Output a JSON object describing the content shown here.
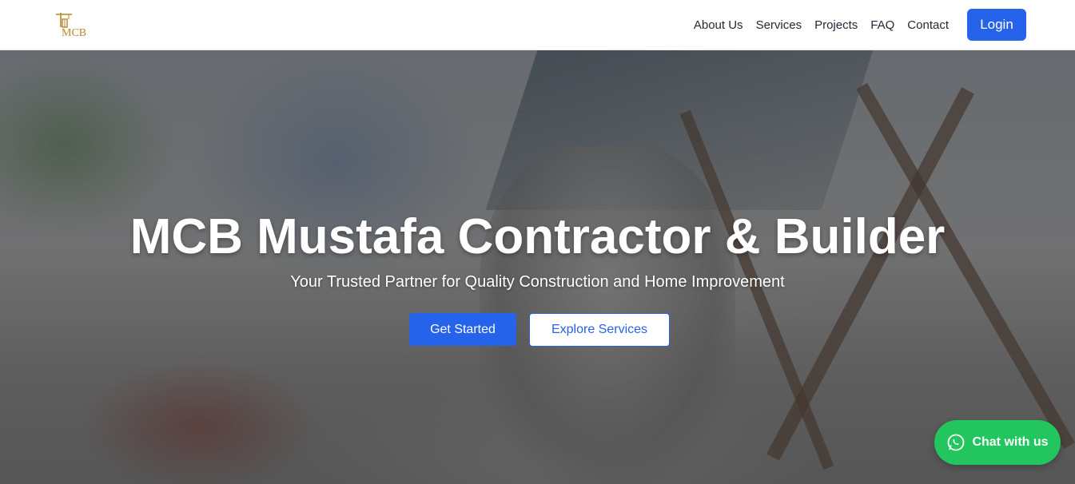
{
  "brand": {
    "logo_text": "MCB",
    "logo_color": "#b8862b"
  },
  "nav": {
    "links": [
      "About Us",
      "Services",
      "Projects",
      "FAQ",
      "Contact"
    ],
    "login_label": "Login"
  },
  "hero": {
    "title": "MCB Mustafa Contractor & Builder",
    "subtitle": "Your Trusted Partner for Quality Construction and Home Improvement",
    "primary_cta": "Get Started",
    "secondary_cta": "Explore Services"
  },
  "chat": {
    "label": "Chat with us",
    "icon": "whatsapp-icon"
  },
  "colors": {
    "accent": "#2563eb",
    "chat": "#22c55e"
  }
}
